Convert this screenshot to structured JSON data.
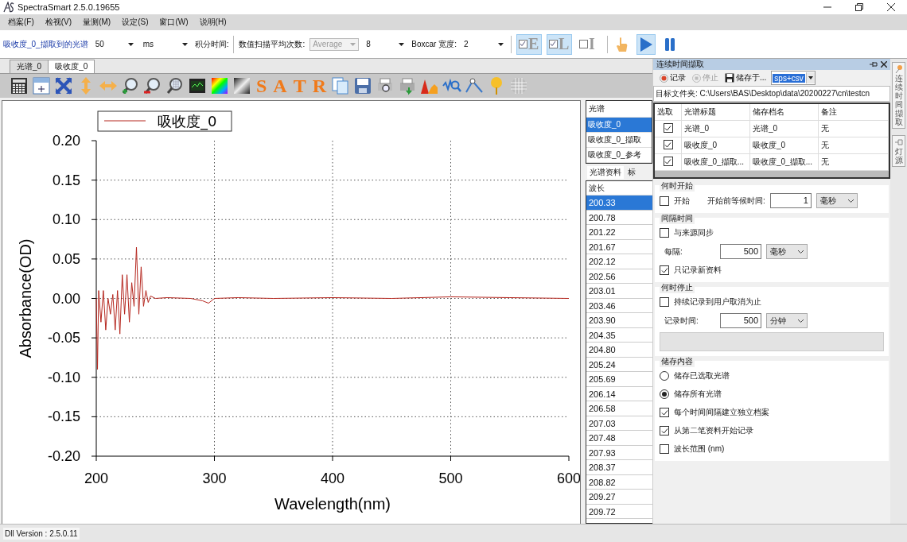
{
  "window": {
    "title": "SpectraSmart 2.5.0.19655"
  },
  "menu": [
    "档案(F)",
    "检视(V)",
    "量测(M)",
    "设定(S)",
    "窗口(W)",
    "说明(H)"
  ],
  "toolbar": {
    "spectrum_label": "吸收度_0_擷取到的光谱",
    "integration_value": "50",
    "integration_unit": "ms",
    "integration_label": "积分时间:",
    "average_label": "数值扫描平均次数:",
    "average_mode": {
      "value": "Average",
      "disabled": true
    },
    "average_count": "8",
    "boxcar_label": "Boxcar 宽度:",
    "boxcar_value": "2",
    "toggles": [
      {
        "letter": "E",
        "checked": true
      },
      {
        "letter": "L",
        "checked": true
      },
      {
        "letter": "I",
        "checked": false
      }
    ],
    "run_buttons": [
      {
        "kind": "hand",
        "selected": false
      },
      {
        "kind": "play",
        "selected": true
      },
      {
        "kind": "pause",
        "selected": false
      }
    ]
  },
  "tabs": [
    {
      "label": "光谱_0",
      "selected": false
    },
    {
      "label": "吸收度_0",
      "selected": true
    }
  ],
  "icon_toolbar": {
    "letters": [
      "S",
      "A",
      "T",
      "R"
    ]
  },
  "chart": {
    "chart_data": {
      "type": "line",
      "grid": true,
      "xlabel": "Wavelength(nm)",
      "ylabel": "Absorbance(OD)",
      "x": [
        200,
        201,
        202,
        204,
        206,
        208,
        210,
        212,
        214,
        216,
        218,
        220,
        222,
        224,
        226,
        228,
        230,
        232,
        234,
        236,
        238,
        240,
        242,
        244,
        246,
        250,
        260,
        280,
        290,
        295,
        300,
        320,
        350,
        400,
        450,
        500,
        550,
        600
      ],
      "series": [
        {
          "name": "吸收度_0",
          "color": "#b5261e",
          "values": [
            0,
            -0.09,
            0.01,
            -0.03,
            0.01,
            -0.04,
            0.0,
            -0.02,
            0.005,
            -0.04,
            0.01,
            -0.045,
            0.03,
            -0.02,
            0.03,
            -0.03,
            0.02,
            -0.01,
            0.065,
            -0.02,
            0.04,
            -0.01,
            0.01,
            -0.005,
            0.003,
            0,
            0.001,
            0,
            -0.003,
            -0.006,
            0,
            0.001,
            0,
            0.001,
            0,
            0.002,
            0.001,
            0
          ]
        }
      ],
      "xlim": [
        200,
        600
      ],
      "ylim": [
        -0.2,
        0.2
      ],
      "xticks": [
        200,
        300,
        400,
        500,
        600
      ],
      "yticks": [
        {
          "value": 0.2,
          "label": "0.20"
        },
        {
          "value": 0.15,
          "label": "0.15"
        },
        {
          "value": 0.1,
          "label": "0.10"
        },
        {
          "value": 0.05,
          "label": "0.05"
        },
        {
          "value": 0,
          "label": "0.00"
        },
        {
          "value": -0.05,
          "label": "-0.05"
        },
        {
          "value": -0.1,
          "label": "-0.10"
        },
        {
          "value": -0.15,
          "label": "-0.15"
        },
        {
          "value": -0.2,
          "label": "-0.20"
        }
      ]
    }
  },
  "spectrum_list": {
    "header": "光谱",
    "items": [
      {
        "label": "吸收度_0",
        "selected": true
      },
      {
        "label": "吸收度_0_擷取",
        "selected": false
      },
      {
        "label": "吸收度_0_参考",
        "selected": false
      }
    ],
    "tabs": [
      {
        "label": "光谱资料",
        "selected": true
      },
      {
        "label": "标",
        "selected": false
      }
    ],
    "table": {
      "header": "波长",
      "rows": [
        {
          "value": "200.33",
          "selected": true
        },
        {
          "value": "200.78",
          "selected": false
        },
        {
          "value": "201.22",
          "selected": false
        },
        {
          "value": "201.67",
          "selected": false
        },
        {
          "value": "202.12",
          "selected": false
        },
        {
          "value": "202.56",
          "selected": false
        },
        {
          "value": "203.01",
          "selected": false
        },
        {
          "value": "203.46",
          "selected": false
        },
        {
          "value": "203.90",
          "selected": false
        },
        {
          "value": "204.35",
          "selected": false
        },
        {
          "value": "204.80",
          "selected": false
        },
        {
          "value": "205.24",
          "selected": false
        },
        {
          "value": "205.69",
          "selected": false
        },
        {
          "value": "206.14",
          "selected": false
        },
        {
          "value": "206.58",
          "selected": false
        },
        {
          "value": "207.03",
          "selected": false
        },
        {
          "value": "207.48",
          "selected": false
        },
        {
          "value": "207.93",
          "selected": false
        },
        {
          "value": "208.37",
          "selected": false
        },
        {
          "value": "208.82",
          "selected": false
        },
        {
          "value": "209.27",
          "selected": false
        },
        {
          "value": "209.72",
          "selected": false
        }
      ]
    }
  },
  "dock": {
    "title": "连续时间擷取",
    "actions": [
      {
        "label": "记录",
        "kind": "record",
        "disabled": false
      },
      {
        "label": "停止",
        "kind": "stop",
        "disabled": true
      },
      {
        "label": "储存于...",
        "kind": "save",
        "disabled": false
      }
    ],
    "format": "sps+csv",
    "folder": "目标文件夹: C:\\Users\\BAS\\Desktop\\data\\20200227\\cn\\testcn",
    "table": {
      "columns": [
        "选取",
        "光谱标题",
        "储存档名",
        "备注"
      ],
      "rows": [
        {
          "checked": true,
          "title": "光谱_0",
          "file": "光谱_0",
          "note": "无"
        },
        {
          "checked": true,
          "title": "吸收度_0",
          "file": "吸收度_0",
          "note": "无"
        },
        {
          "checked": true,
          "title": "吸收度_0_擷取...",
          "file": "吸收度_0_擷取...",
          "note": "无"
        }
      ]
    },
    "groups": [
      {
        "title": "何时开始",
        "items": [
          {
            "kind": "checkbox_field",
            "label": "开始",
            "checked": false,
            "field_label": "开始前等候时间:",
            "value": "1",
            "unit": "毫秒"
          }
        ]
      },
      {
        "title": "间隔时间",
        "items": [
          {
            "kind": "checkbox",
            "label": "与来源同步",
            "checked": false
          },
          {
            "kind": "field",
            "field_label": "每隔:",
            "value": "500",
            "unit": "毫秒"
          },
          {
            "kind": "checkbox",
            "label": "只记录新资料",
            "checked": true
          }
        ]
      },
      {
        "title": "何时停止",
        "items": [
          {
            "kind": "checkbox",
            "label": "持续记录到用户取消为止",
            "checked": false
          },
          {
            "kind": "field",
            "field_label": "记录时间:",
            "value": "500",
            "unit": "分钟"
          },
          {
            "kind": "bar"
          }
        ]
      },
      {
        "title": "储存内容",
        "items": [
          {
            "kind": "radio",
            "label": "储存已选取光谱",
            "selected": false
          },
          {
            "kind": "radio",
            "label": "储存所有光谱",
            "selected": true
          },
          {
            "kind": "checkbox",
            "label": "每个时间间隔建立独立档案",
            "checked": true
          },
          {
            "kind": "checkbox",
            "label": "从第二笔资料开始记录",
            "checked": true
          },
          {
            "kind": "checkbox",
            "label": "波长范围 (nm)",
            "checked": false
          }
        ]
      }
    ]
  },
  "side_tabs": [
    {
      "label": "连续时间擷取"
    },
    {
      "label": "灯源"
    }
  ],
  "status_bar": {
    "text": "Dll Version : 2.5.0.11"
  }
}
